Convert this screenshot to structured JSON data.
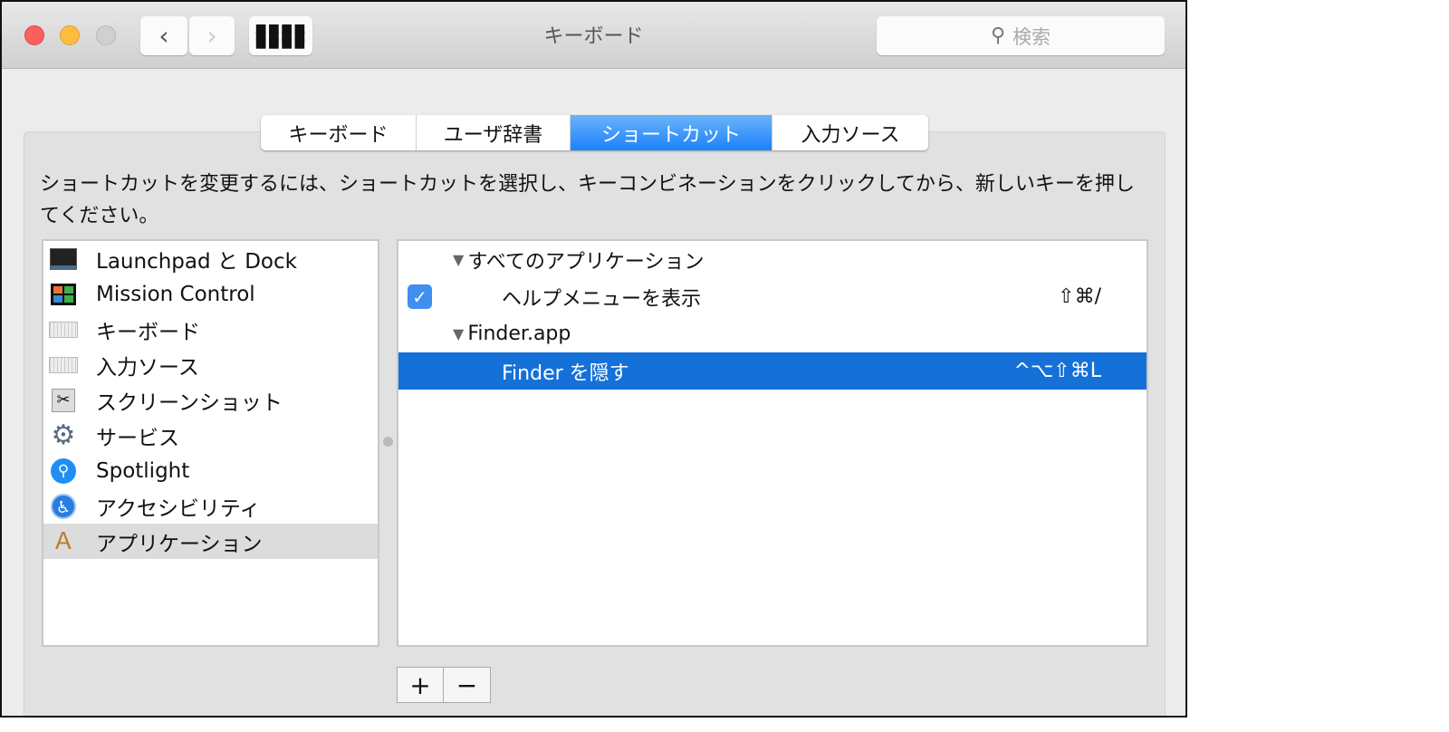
{
  "window": {
    "title": "キーボード",
    "search_placeholder": "検索"
  },
  "tabs": [
    {
      "label": "キーボード"
    },
    {
      "label": "ユーザ辞書"
    },
    {
      "label": "ショートカット"
    },
    {
      "label": "入力ソース"
    }
  ],
  "description": "ショートカットを変更するには、ショートカットを選択し、キーコンビネーションをクリックしてから、新しいキーを押してください。",
  "categories": [
    {
      "label": "Launchpad と Dock",
      "icon": "launchpad-icon"
    },
    {
      "label": "Mission Control",
      "icon": "mission-control-icon"
    },
    {
      "label": "キーボード",
      "icon": "keyboard-icon"
    },
    {
      "label": "入力ソース",
      "icon": "keyboard-icon"
    },
    {
      "label": "スクリーンショット",
      "icon": "screenshot-icon"
    },
    {
      "label": "サービス",
      "icon": "gear-icon"
    },
    {
      "label": "Spotlight",
      "icon": "spotlight-icon"
    },
    {
      "label": "アクセシビリティ",
      "icon": "accessibility-icon"
    },
    {
      "label": "アプリケーション",
      "icon": "applications-icon"
    }
  ],
  "shortcuts": [
    {
      "group": "すべてのアプリケーション"
    },
    {
      "label": "ヘルプメニューを表示",
      "key": "⇧⌘/",
      "checked": true
    },
    {
      "group": "Finder.app"
    },
    {
      "label": "Finder を隠す",
      "key": "^⌥⇧⌘L"
    }
  ],
  "buttons": {
    "add": "+",
    "remove": "−"
  },
  "colors": {
    "accent": "#1570d8",
    "close": "#fc605c",
    "minimize": "#fdbc40"
  }
}
